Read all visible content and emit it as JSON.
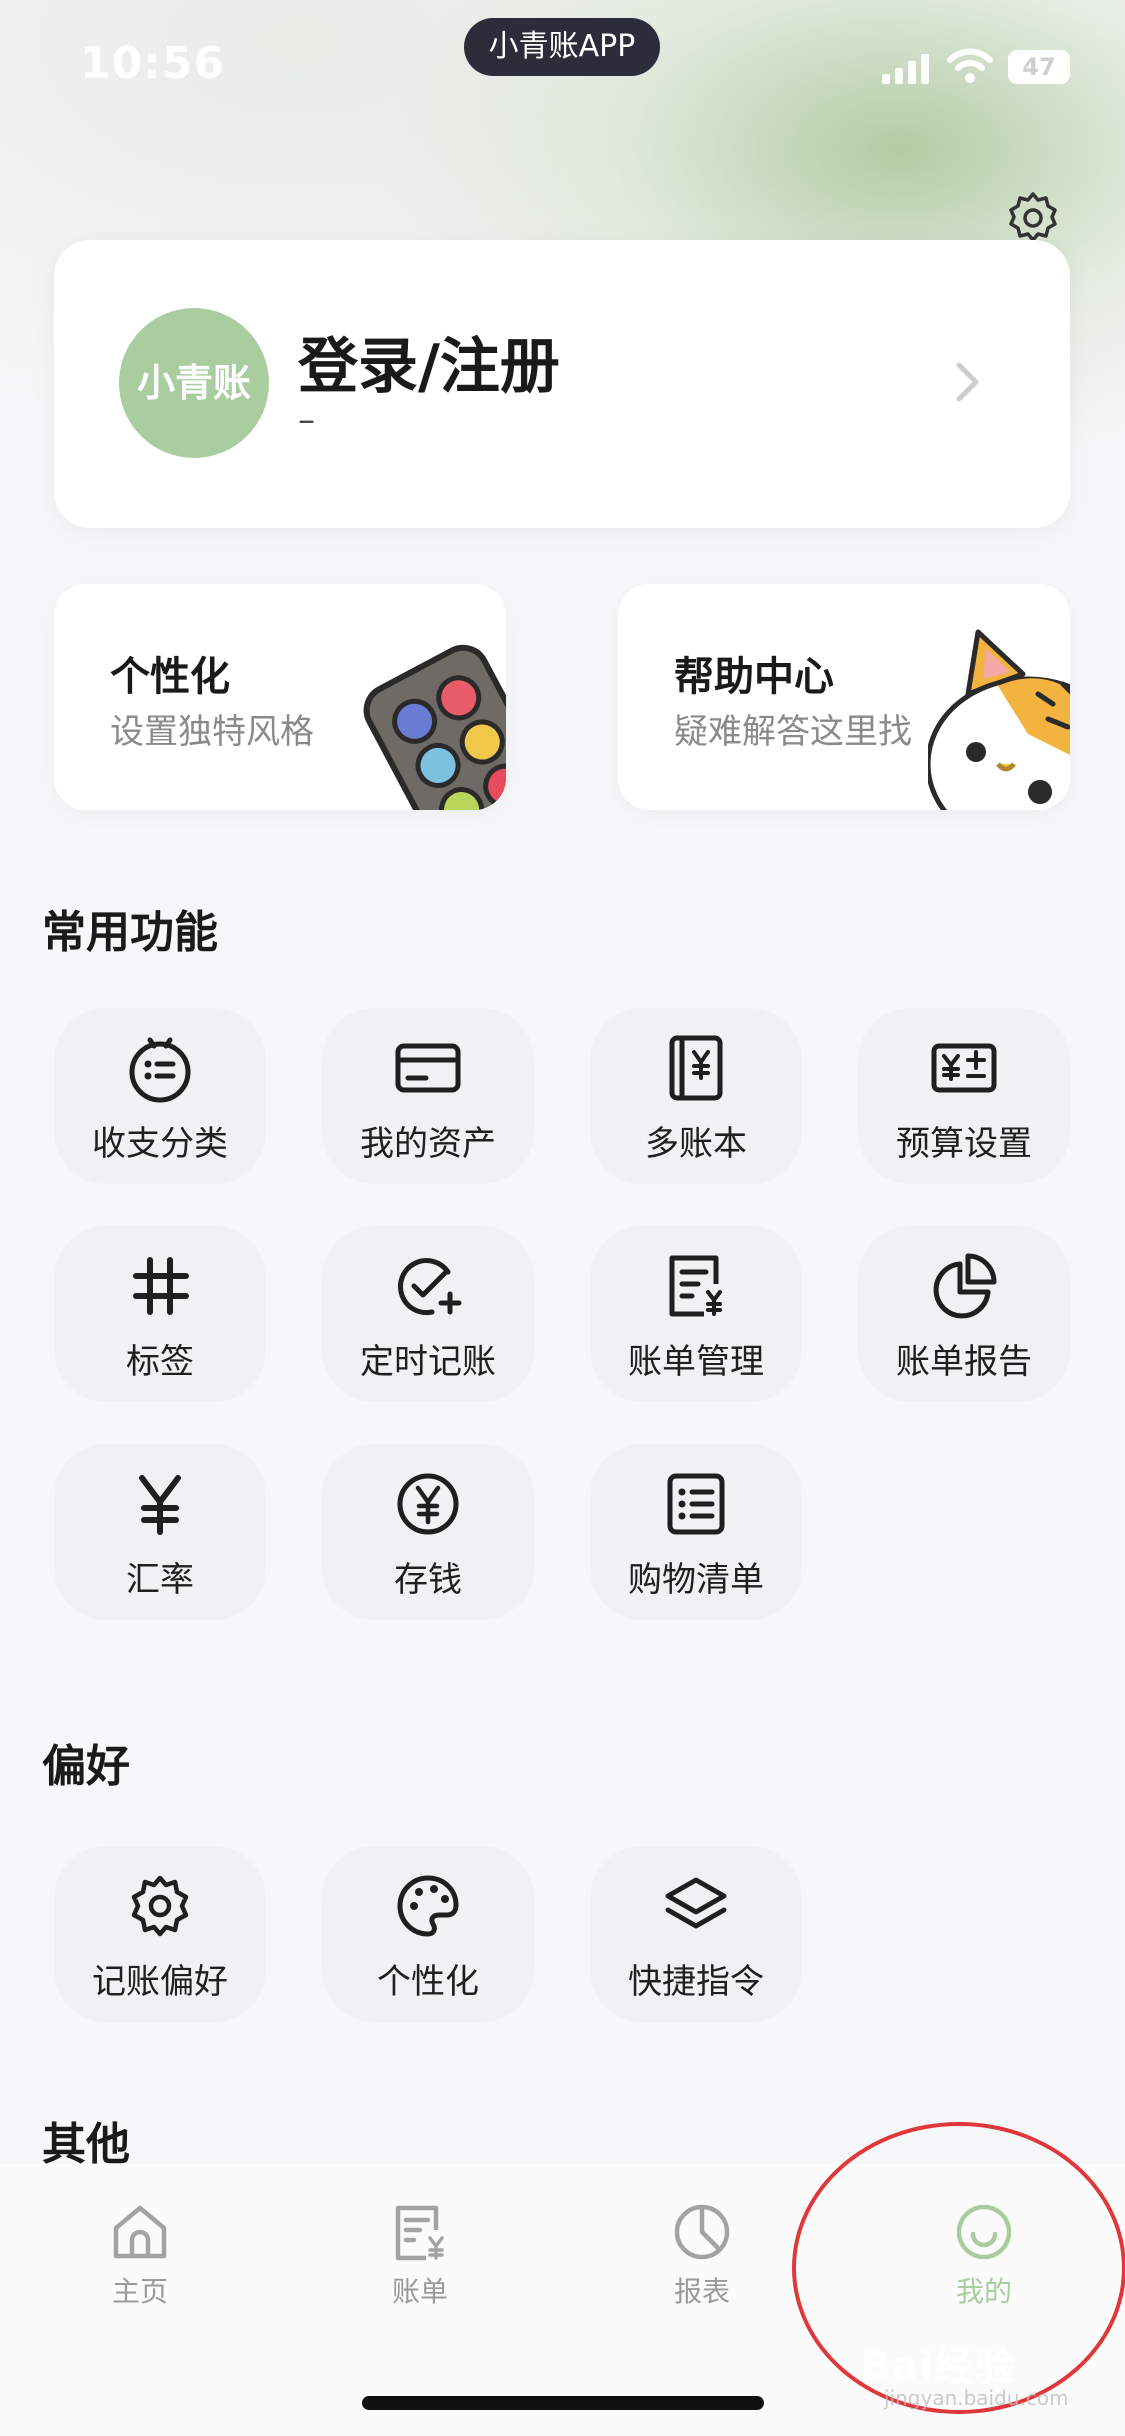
{
  "status_bar": {
    "time": "10:56",
    "app_pill": "小青账APP",
    "battery": "47"
  },
  "profile": {
    "avatar_text": "小青账",
    "title": "登录/注册",
    "subtitle": "–"
  },
  "promos": [
    {
      "title": "个性化",
      "subtitle": "设置独特风格"
    },
    {
      "title": "帮助中心",
      "subtitle": "疑难解答这里找"
    }
  ],
  "sections": {
    "common": {
      "title": "常用功能",
      "items": [
        {
          "label": "收支分类",
          "icon": "category-icon"
        },
        {
          "label": "我的资产",
          "icon": "card-icon"
        },
        {
          "label": "多账本",
          "icon": "ledger-book-icon"
        },
        {
          "label": "预算设置",
          "icon": "budget-icon"
        },
        {
          "label": "标签",
          "icon": "hashtag-icon"
        },
        {
          "label": "定时记账",
          "icon": "scheduled-check-icon"
        },
        {
          "label": "账单管理",
          "icon": "bill-manage-icon"
        },
        {
          "label": "账单报告",
          "icon": "pie-report-icon"
        },
        {
          "label": "汇率",
          "icon": "yen-icon"
        },
        {
          "label": "存钱",
          "icon": "coin-yen-icon"
        },
        {
          "label": "购物清单",
          "icon": "list-icon"
        }
      ]
    },
    "preferences": {
      "title": "偏好",
      "items": [
        {
          "label": "记账偏好",
          "icon": "gear-icon"
        },
        {
          "label": "个性化",
          "icon": "palette-icon"
        },
        {
          "label": "快捷指令",
          "icon": "layers-icon"
        }
      ]
    },
    "other": {
      "title": "其他"
    }
  },
  "tabbar": {
    "active": "我的",
    "accent_color": "#a9cd9f",
    "tabs": [
      {
        "label": "主页",
        "icon": "home-icon"
      },
      {
        "label": "账单",
        "icon": "bill-icon"
      },
      {
        "label": "报表",
        "icon": "report-icon"
      },
      {
        "label": "我的",
        "icon": "smile-icon"
      }
    ]
  },
  "watermark": {
    "brand": "Bai经验",
    "url": "jingyan.baidu.com"
  }
}
